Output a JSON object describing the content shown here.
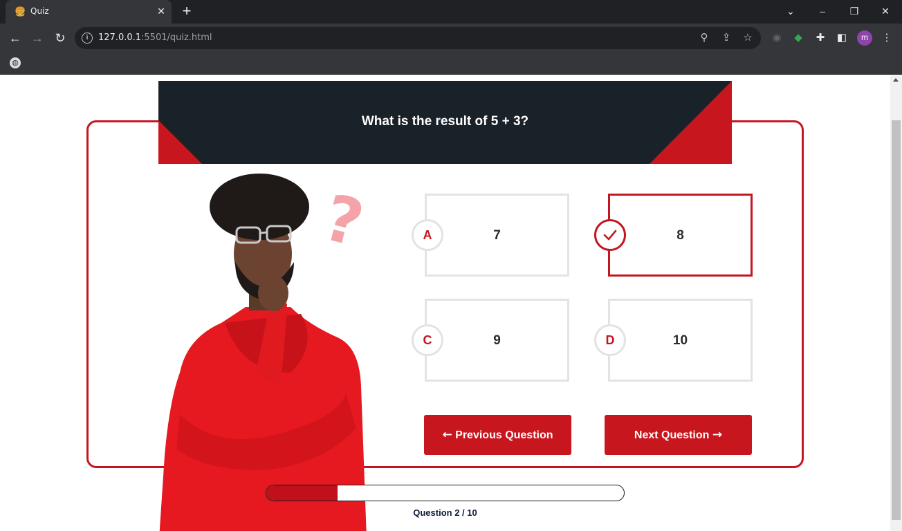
{
  "browser": {
    "tab_title": "Quiz",
    "tab_favicon": "🍔",
    "url_host": "127.0.0.1",
    "url_rest": ":5501/quiz.html",
    "profile_initial": "m"
  },
  "quiz": {
    "question": "What is the result of 5 + 3?",
    "options": [
      {
        "letter": "A",
        "value": "7",
        "selected": false
      },
      {
        "letter": "",
        "value": "8",
        "selected": true
      },
      {
        "letter": "C",
        "value": "9",
        "selected": false
      },
      {
        "letter": "D",
        "value": "10",
        "selected": false
      }
    ],
    "prev_label": "Previous Question",
    "next_label": "Next Question",
    "progress_text": "Question 2 / 10",
    "progress_fraction": 0.2,
    "colors": {
      "accent": "#c8161e",
      "banner": "#1a2229",
      "option_border": "#e3e3e3"
    }
  }
}
